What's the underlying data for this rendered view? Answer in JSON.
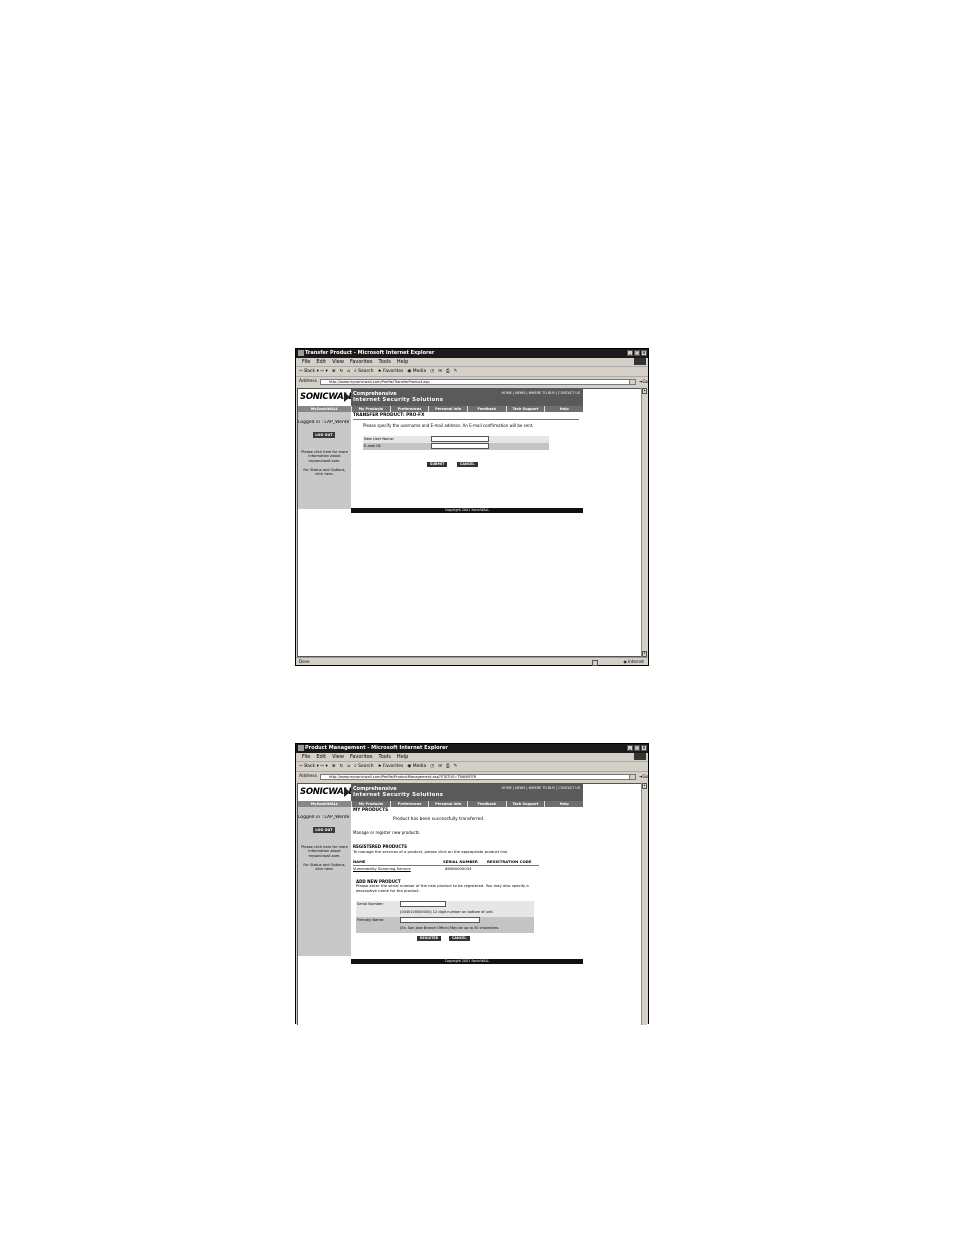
{
  "screens": [
    {
      "window_title": "Transfer Product - Microsoft Internet Explorer",
      "menu": [
        "File",
        "Edit",
        "View",
        "Favorites",
        "Tools",
        "Help"
      ],
      "toolbar": [
        "Back",
        "Search",
        "Favorites",
        "Media"
      ],
      "address_label": "Address",
      "address_url": "http://www.mysonicwall.com/Profile/TransferProduct.asp",
      "go_label": "Go",
      "status_left": "Done",
      "status_zone": "Internet",
      "site": {
        "logo": "SONICWALL",
        "banner_line1": "Comprehensive",
        "banner_line2": "Internet Security Solutions",
        "top_links": "HOME | NEWS | WHERE TO BUY | CONTACT US",
        "side_header": "MySonicWALL",
        "nav": [
          "My Products",
          "Preferences",
          "Personal Info",
          "Feedback",
          "Tech Support",
          "Help"
        ],
        "logged_in": "Logged in : LAP_Wente",
        "logout": "LOG OUT",
        "help_text": "Please click here for more information about mysonicwall.com.",
        "status_text": "For Status and Options, click here.",
        "footer": "Copyright 2001 SonicWALL"
      },
      "content": {
        "heading": "TRANSFER PRODUCT: PRO-FX",
        "instruction": "Please specify the username and E-mail address. An E-mail confirmation will be sent.",
        "user_label": "New User Name:",
        "email_label": "E-mail ID:",
        "submit": "SUBMIT",
        "cancel": "CANCEL"
      }
    },
    {
      "window_title": "Product Management - Microsoft Internet Explorer",
      "menu": [
        "File",
        "Edit",
        "View",
        "Favorites",
        "Tools",
        "Help"
      ],
      "toolbar": [
        "Back",
        "Search",
        "Favorites",
        "Media"
      ],
      "address_label": "Address",
      "address_url": "http://www.mysonicwall.com/Profile/ProductManagement.asp?STATUS=TRANSFER",
      "go_label": "Go",
      "site": {
        "logo": "SONICWALL",
        "banner_line1": "Comprehensive",
        "banner_line2": "Internet Security Solutions",
        "top_links": "HOME | NEWS | WHERE TO BUY | CONTACT US",
        "side_header": "MySonicWALL",
        "nav": [
          "My Products",
          "Preferences",
          "Personal Info",
          "Feedback",
          "Tech Support",
          "Help"
        ],
        "logged_in": "Logged in : LAP_Wente",
        "logout": "LOG OUT",
        "help_text": "Please click here for more information about mysonicwall.com.",
        "status_text": "For Status and Options, click here.",
        "footer": "Copyright 2001 SonicWALL"
      },
      "content": {
        "heading": "MY PRODUCTS",
        "success": "Product has been successfully transferred.",
        "manage": "Manage or register new products.",
        "registered_heading": "REGISTERED PRODUCTS",
        "registered_desc": "To manage the services of a product, please click on the appropriate product link.",
        "columns": [
          "NAME",
          "SERIAL NUMBER",
          "REGISTRATION CODE"
        ],
        "rows": [
          {
            "name": "Vulnerability Scanning Service",
            "serial": "88080000034",
            "code": ""
          }
        ],
        "add_heading": "ADD NEW PRODUCT",
        "add_desc": "Please enter the serial number of the new product to be registered. You may also specify a descriptive name for the product.",
        "serial_label": "Serial Number:",
        "serial_hint": "(0040100000000) 12 digit number on bottom of unit.",
        "friendly_label": "Friendly Name:",
        "friendly_hint": "(Ex. San Jose Branch Office) May be up to 30 characters.",
        "register": "REGISTER",
        "cancel": "CANCEL"
      }
    }
  ]
}
